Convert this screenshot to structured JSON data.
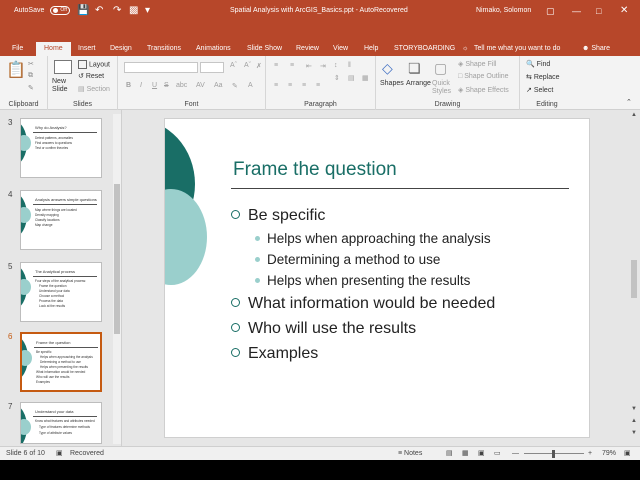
{
  "titlebar": {
    "autosave_label": "AutoSave",
    "autosave_state": "Off",
    "doc_title": "Spatial Analysis with ArcGIS_Basics.ppt - AutoRecovered",
    "user": "Nimako, Solomon"
  },
  "tabs": [
    "File",
    "Home",
    "Insert",
    "Design",
    "Transitions",
    "Animations",
    "Slide Show",
    "Review",
    "View",
    "Help",
    "STORYBOARDING"
  ],
  "active_tab": "Home",
  "tell_me": "Tell me what you want to do",
  "share_label": "Share",
  "ribbon": {
    "clipboard": {
      "label": "Clipboard"
    },
    "slides": {
      "label": "Slides",
      "new_slide": "New Slide",
      "layout": "Layout",
      "reset": "Reset",
      "section": "Section"
    },
    "font": {
      "label": "Font",
      "bold": "B",
      "italic": "I",
      "underline": "U",
      "strike": "S",
      "shadow": "abc"
    },
    "paragraph": {
      "label": "Paragraph"
    },
    "drawing": {
      "label": "Drawing",
      "shapes": "Shapes",
      "arrange": "Arrange",
      "quick_styles": "Quick Styles",
      "shape_fill": "Shape Fill",
      "shape_outline": "Shape Outline",
      "shape_effects": "Shape Effects"
    },
    "editing": {
      "label": "Editing",
      "find": "Find",
      "replace": "Replace",
      "select": "Select"
    }
  },
  "thumbnails": [
    {
      "num": "3",
      "title": "Why do Analysis?",
      "bullets": [
        "Detect patterns, anomalies",
        "Find answers to questions",
        "Test or confirm theories"
      ],
      "selected": false
    },
    {
      "num": "4",
      "title": "Analysis answers simple questions",
      "bullets": [
        "Map where things are located",
        "Density mapping",
        "Classify locations",
        "Map change"
      ],
      "selected": false
    },
    {
      "num": "5",
      "title": "The Analytical process",
      "bullets": [
        "Four steps of the analytical process:",
        "Frame the question",
        "Understand your data",
        "Choose a method",
        "Process the data",
        "Look at the results"
      ],
      "selected": false
    },
    {
      "num": "6",
      "title": "Frame the question",
      "bullets": [
        "Be specific",
        "Helps when approaching the analysis",
        "Determining a method to use",
        "Helps when presenting the results",
        "What information would be needed",
        "Who will use the results",
        "Examples"
      ],
      "selected": true
    },
    {
      "num": "7",
      "title": "Understand your data",
      "bullets": [
        "Know what features and attributes needed",
        "Type of features determine methods",
        "Type of attribute values"
      ],
      "selected": false
    }
  ],
  "slide": {
    "title": "Frame the question",
    "bullets": [
      {
        "level": 1,
        "text": "Be specific"
      },
      {
        "level": 2,
        "text": "Helps when approaching the analysis"
      },
      {
        "level": 2,
        "text": "Determining a method to use"
      },
      {
        "level": 2,
        "text": "Helps when presenting the results"
      },
      {
        "level": 1,
        "text": "What information would be needed"
      },
      {
        "level": 1,
        "text": "Who will use the results"
      },
      {
        "level": 1,
        "text": "Examples"
      }
    ]
  },
  "status": {
    "slide_info": "Slide 6 of 10",
    "recovered": "Recovered",
    "notes": "Notes",
    "zoom": "79%"
  },
  "colors": {
    "brand": "#b7472a",
    "teal": "#196e66",
    "light_teal": "#9acfcc",
    "selected_thumb": "#c55a11"
  }
}
